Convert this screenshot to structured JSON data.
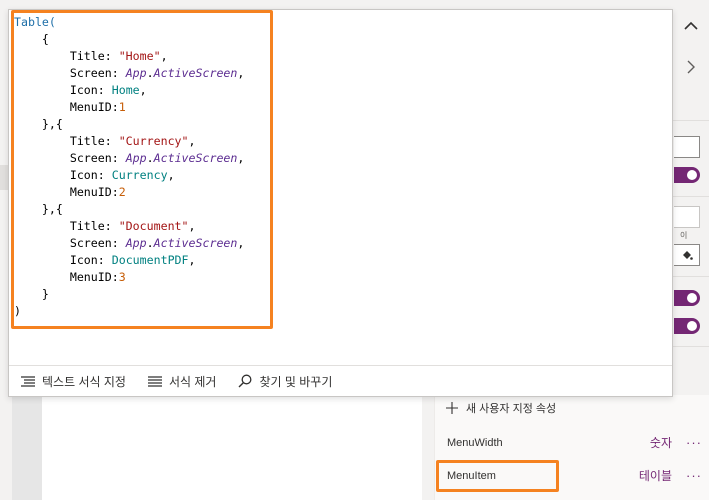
{
  "code_lines": [
    [
      {
        "t": "Table(",
        "c": "kw"
      }
    ],
    [
      {
        "t": "    {",
        "c": ""
      }
    ],
    [
      {
        "t": "        Title: ",
        "c": ""
      },
      {
        "t": "\"Home\"",
        "c": "str"
      },
      {
        "t": ",",
        "c": ""
      }
    ],
    [
      {
        "t": "        Screen: ",
        "c": ""
      },
      {
        "t": "App",
        "c": "it"
      },
      {
        "t": ".",
        "c": ""
      },
      {
        "t": "ActiveScreen",
        "c": "it"
      },
      {
        "t": ",",
        "c": ""
      }
    ],
    [
      {
        "t": "        Icon: ",
        "c": ""
      },
      {
        "t": "Home",
        "c": "id"
      },
      {
        "t": ",",
        "c": ""
      }
    ],
    [
      {
        "t": "        MenuID:",
        "c": ""
      },
      {
        "t": "1",
        "c": "num"
      }
    ],
    [
      {
        "t": "    },{",
        "c": ""
      }
    ],
    [
      {
        "t": "        Title: ",
        "c": ""
      },
      {
        "t": "\"Currency\"",
        "c": "str"
      },
      {
        "t": ",",
        "c": ""
      }
    ],
    [
      {
        "t": "        Screen: ",
        "c": ""
      },
      {
        "t": "App",
        "c": "it"
      },
      {
        "t": ".",
        "c": ""
      },
      {
        "t": "ActiveScreen",
        "c": "it"
      },
      {
        "t": ",",
        "c": ""
      }
    ],
    [
      {
        "t": "        Icon: ",
        "c": ""
      },
      {
        "t": "Currency",
        "c": "id"
      },
      {
        "t": ",",
        "c": ""
      }
    ],
    [
      {
        "t": "        MenuID:",
        "c": ""
      },
      {
        "t": "2",
        "c": "num"
      }
    ],
    [
      {
        "t": "    },{",
        "c": ""
      }
    ],
    [
      {
        "t": "        Title: ",
        "c": ""
      },
      {
        "t": "\"Document\"",
        "c": "str"
      },
      {
        "t": ",",
        "c": ""
      }
    ],
    [
      {
        "t": "        Screen: ",
        "c": ""
      },
      {
        "t": "App",
        "c": "it"
      },
      {
        "t": ".",
        "c": ""
      },
      {
        "t": "ActiveScreen",
        "c": "it"
      },
      {
        "t": ",",
        "c": ""
      }
    ],
    [
      {
        "t": "        Icon: ",
        "c": ""
      },
      {
        "t": "DocumentPDF",
        "c": "id"
      },
      {
        "t": ",",
        "c": ""
      }
    ],
    [
      {
        "t": "        MenuID:",
        "c": ""
      },
      {
        "t": "3",
        "c": "num"
      }
    ],
    [
      {
        "t": "    }",
        "c": ""
      }
    ],
    [
      {
        "t": ")",
        "c": ""
      }
    ]
  ],
  "editor_footer": {
    "format_text": "텍스트 서식 지정",
    "remove_format": "서식 제거",
    "find_replace": "찾기 및 바꾸기"
  },
  "right_panel": {
    "small_text": "이",
    "add_custom_property": "새 사용자 지정 속성",
    "properties": [
      {
        "name": "MenuWidth",
        "type": "숫자",
        "more": "···"
      },
      {
        "name": "MenuItem",
        "type": "테이블",
        "more": "···"
      }
    ]
  },
  "colors": {
    "accent": "#742774",
    "highlight": "#f58220",
    "keyword": "#1e6fa8",
    "string": "#a31515",
    "identifier": "#008080",
    "number": "#c65d07"
  },
  "icons": {
    "collapse": "chevron-up-icon",
    "expand": "chevron-right-icon",
    "format_text": "format-text-icon",
    "remove_format": "remove-format-icon",
    "find_replace": "search-icon",
    "add": "plus-icon",
    "fill": "paint-bucket-icon"
  }
}
